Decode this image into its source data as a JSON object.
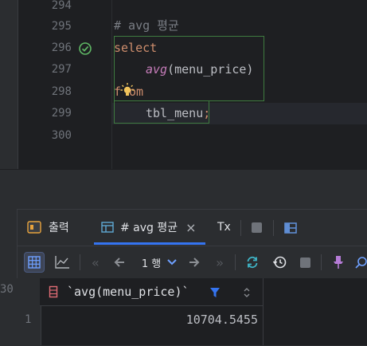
{
  "editor": {
    "line_numbers": [
      "294",
      "295",
      "296",
      "297",
      "298",
      "299",
      "300"
    ],
    "comment": "# avg 평균",
    "kw_select": "select",
    "fn_avg": "avg",
    "arg": "(menu_price)",
    "kw_from_pre": "f",
    "kw_from_post": "om",
    "table_name": "tbl_menu",
    "semicolon": ";"
  },
  "panel": {
    "tabs": [
      {
        "label": "출력",
        "icon": "output-icon"
      },
      {
        "label": "# avg 평균",
        "icon": "table-icon",
        "close": "×"
      },
      {
        "label": "Tx",
        "icon": "transaction-icon"
      }
    ],
    "toolbar": {
      "page_label": "1 행",
      "icons": [
        "table-view-icon",
        "chart-icon",
        "first-page-icon",
        "prev-page-icon",
        "dropdown-icon",
        "next-page-icon",
        "last-page-icon",
        "refresh-icon",
        "history-icon",
        "stop-icon",
        "pin-icon",
        "search-icon"
      ]
    },
    "grid": {
      "gutter_label": "30",
      "column_header": "`avg(menu_price)`",
      "rows": [
        {
          "row_num": "1",
          "value": "10704.5455"
        }
      ]
    }
  },
  "colors": {
    "accent": "#3574f0",
    "keyword": "#cf8e6d",
    "function": "#c77dbb",
    "success": "#5fb865"
  }
}
